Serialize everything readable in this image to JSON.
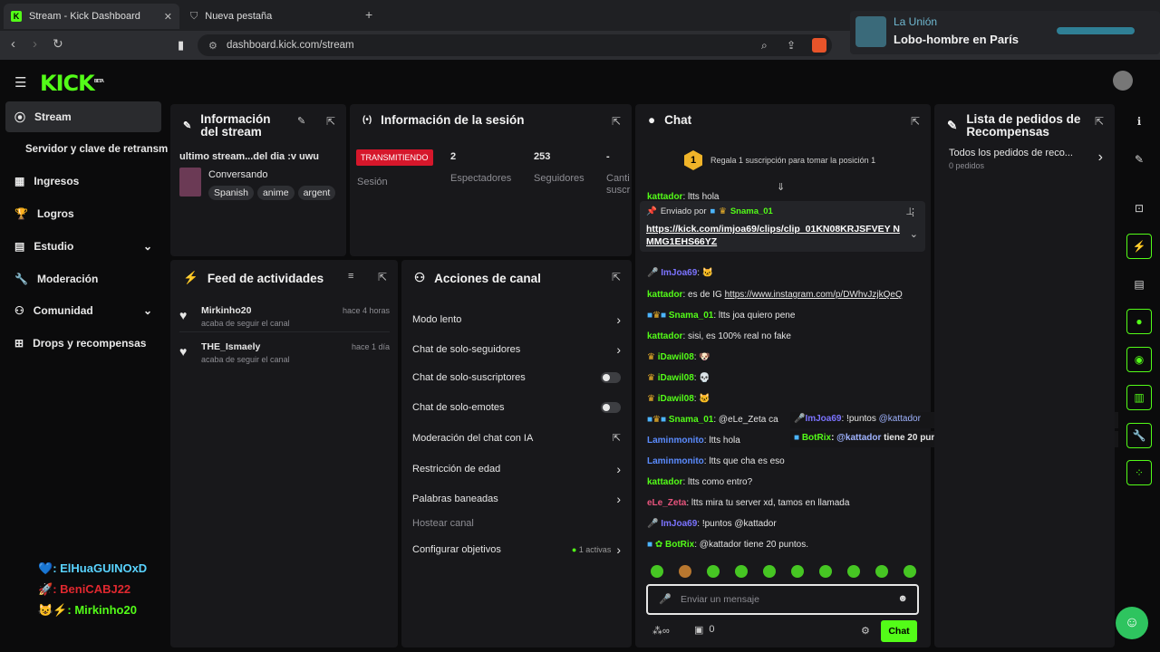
{
  "browser": {
    "tabs": [
      {
        "title": "Stream - Kick Dashboard",
        "icon": "kick-icon"
      },
      {
        "title": "Nueva pestaña",
        "icon": "shield-icon"
      }
    ],
    "url": "dashboard.kick.com/stream"
  },
  "notification": {
    "title": "La Unión",
    "subtitle": "Lobo-hombre en París"
  },
  "logo": "KICK",
  "logo_badge": "BETA",
  "sidebar": {
    "items": [
      {
        "label": "Stream",
        "icon": "broadcast-icon"
      },
      {
        "label": "Servidor y clave de retransm",
        "icon": ""
      },
      {
        "label": "Ingresos",
        "icon": "chart-icon"
      },
      {
        "label": "Logros",
        "icon": "trophy-icon"
      },
      {
        "label": "Estudio",
        "icon": "studio-icon",
        "chev": "⌄"
      },
      {
        "label": "Moderación",
        "icon": "wrench-icon"
      },
      {
        "label": "Comunidad",
        "icon": "community-icon",
        "chev": "⌄"
      },
      {
        "label": "Drops y recompensas",
        "icon": "gift-icon"
      }
    ]
  },
  "overlay": {
    "lines": [
      {
        "icon": "💙",
        "name": ": ElHuaGUINOxD",
        "color": "#59d3ff"
      },
      {
        "icon": "🚀",
        "name": ": BeniCABJ22",
        "color": "#e0282f"
      },
      {
        "icon": "😺⚡",
        "name": ": Mirkinho20",
        "color": "#53fc18"
      }
    ]
  },
  "stream_info": {
    "title": "Información del stream",
    "stream_title": "ultimo stream...del dia :v uwu",
    "category": "Conversando",
    "tags": [
      "Spanish",
      "anime",
      "argent"
    ]
  },
  "session": {
    "title": "Información de la sesión",
    "status": "TRANSMITIENDO",
    "status_label": "Sesión",
    "stats": [
      {
        "value": "2",
        "label": "Espectadores"
      },
      {
        "value": "253",
        "label": "Seguidores"
      },
      {
        "value": "-",
        "label": "Canti suscr"
      }
    ]
  },
  "activity": {
    "title": "Feed de actividades",
    "items": [
      {
        "user": "Mirkinho20",
        "action": "acaba de seguir el canal",
        "time": "hace 4 horas"
      },
      {
        "user": "THE_Ismaely",
        "action": "acaba de seguir el canal",
        "time": "hace 1 día"
      }
    ]
  },
  "actions": {
    "title": "Acciones de canal",
    "items": [
      {
        "label": "Modo lento",
        "ctl": "chev"
      },
      {
        "label": "Chat de solo-seguidores",
        "ctl": "chev"
      },
      {
        "label": "Chat de solo-suscriptores",
        "ctl": "toggle"
      },
      {
        "label": "Chat de solo-emotes",
        "ctl": "toggle"
      },
      {
        "label": "Moderación del chat con IA",
        "ctl": "ext"
      },
      {
        "label": "Restricción de edad",
        "ctl": "chev"
      },
      {
        "label": "Palabras baneadas",
        "ctl": "chev"
      },
      {
        "label": "Hostear canal",
        "ctl": "none"
      },
      {
        "label": "Configurar objetivos",
        "ctl": "chev",
        "extra": "1 activas"
      }
    ]
  },
  "chat": {
    "title": "Chat",
    "gift_text": "Regala 1 suscripción para tomar la posición 1",
    "gift_num": "1",
    "pinned": {
      "sent_by": "Enviado por",
      "user": "Snama_01",
      "link": "https://kick.com/imjoa69/clips/clip_01KN08KRJSFVEY NMMG1EHS66YZ"
    },
    "messages": [
      {
        "user": "kattador",
        "text": "es de IG",
        "link": "https://www.instagram.com/p/DWhvJzjkQeQ",
        "color": "#53fc18"
      },
      {
        "user": "Snama_01",
        "text": "ltts joa quiero pene",
        "color": "#53fc18"
      },
      {
        "user": "kattador",
        "text": "sisi, es 100% real no fake",
        "color": "#53fc18"
      },
      {
        "user": "iDawil08",
        "text": "",
        "color": "#53fc18"
      },
      {
        "user": "iDawil08",
        "text": "",
        "color": "#53fc18"
      },
      {
        "user": "iDawil08",
        "text": "",
        "color": "#53fc18"
      },
      {
        "user": "Snama_01",
        "text": "@eLe_Zeta ca",
        "color": "#53fc18"
      },
      {
        "user": "Laminmonito",
        "text": "ltts hola",
        "color": "#5b8cff"
      },
      {
        "user": "Laminmonito",
        "text": "ltts que cha es eso",
        "color": "#5b8cff"
      },
      {
        "user": "kattador",
        "text": "ltts como entro?",
        "color": "#53fc18"
      },
      {
        "user": "eLe_Zeta",
        "text": "ltts mira tu server xd, tamos en llamada",
        "color": "#e8547d"
      },
      {
        "user": "ImJoa69",
        "text": "!puntos @kattador",
        "color": "#7b73ff"
      },
      {
        "user": "BotRix",
        "text": "@kattador tiene 20 puntos.",
        "color": "#53fc18"
      }
    ],
    "prev_user": "kattador",
    "prev_text": "ltts hola",
    "prev2_user": "ImJoa69",
    "overlap1": {
      "user": "ImJoa69",
      "text": "!puntos",
      "mention": "@kattador"
    },
    "overlap2": {
      "user": "BotRix",
      "mention": "@kattador",
      "text": "tiene 20 puntos."
    },
    "input_placeholder": "Enviar un mensaje",
    "points": "0",
    "send_label": "Chat"
  },
  "rewards": {
    "title": "Lista de pedidos de Recompensas",
    "item_title": "Todos los pedidos de reco...",
    "item_sub": "0 pedidos"
  }
}
